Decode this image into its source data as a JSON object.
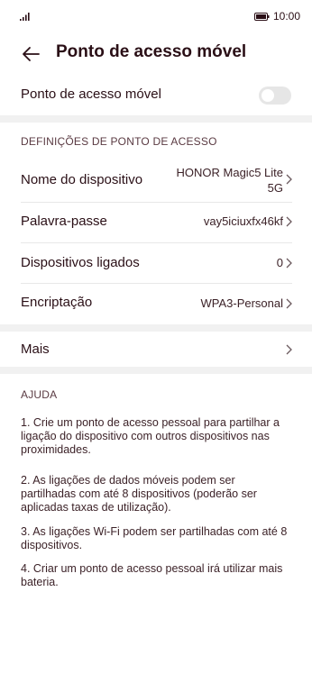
{
  "status": {
    "time": "10:00"
  },
  "header": {
    "title": "Ponto de acesso móvel"
  },
  "hotspot": {
    "label": "Ponto de acesso móvel",
    "enabled": false
  },
  "settings": {
    "section_title": "DEFINIÇÕES DE PONTO DE ACESSO",
    "device_name": {
      "label": "Nome do dispositivo",
      "value_line1": "HONOR Magic5 Lite",
      "value_line2": "5G"
    },
    "password": {
      "label": "Palavra-passe",
      "value": "vay5iciuxfx46kf"
    },
    "connected": {
      "label": "Dispositivos ligados",
      "value": "0"
    },
    "encryption": {
      "label": "Encriptação",
      "value": "WPA3-Personal"
    }
  },
  "more": {
    "label": "Mais"
  },
  "help": {
    "title": "AJUDA",
    "items": [
      "1. Crie um ponto de acesso pessoal para partilhar a ligação do dispositivo com outros dispositivos nas proximidades.",
      "2. As ligações de dados móveis podem ser partilhadas com até 8 dispositivos (poderão ser aplicadas taxas de utilização).",
      "3. As ligações Wi-Fi podem ser partilhadas com até 8 dispositivos.",
      "4. Criar um ponto de acesso pessoal irá utilizar mais bateria."
    ]
  },
  "colors": {
    "text": "#2a0f16",
    "gap": "#f1f1f1",
    "toggle_off": "#e6e6e6"
  }
}
